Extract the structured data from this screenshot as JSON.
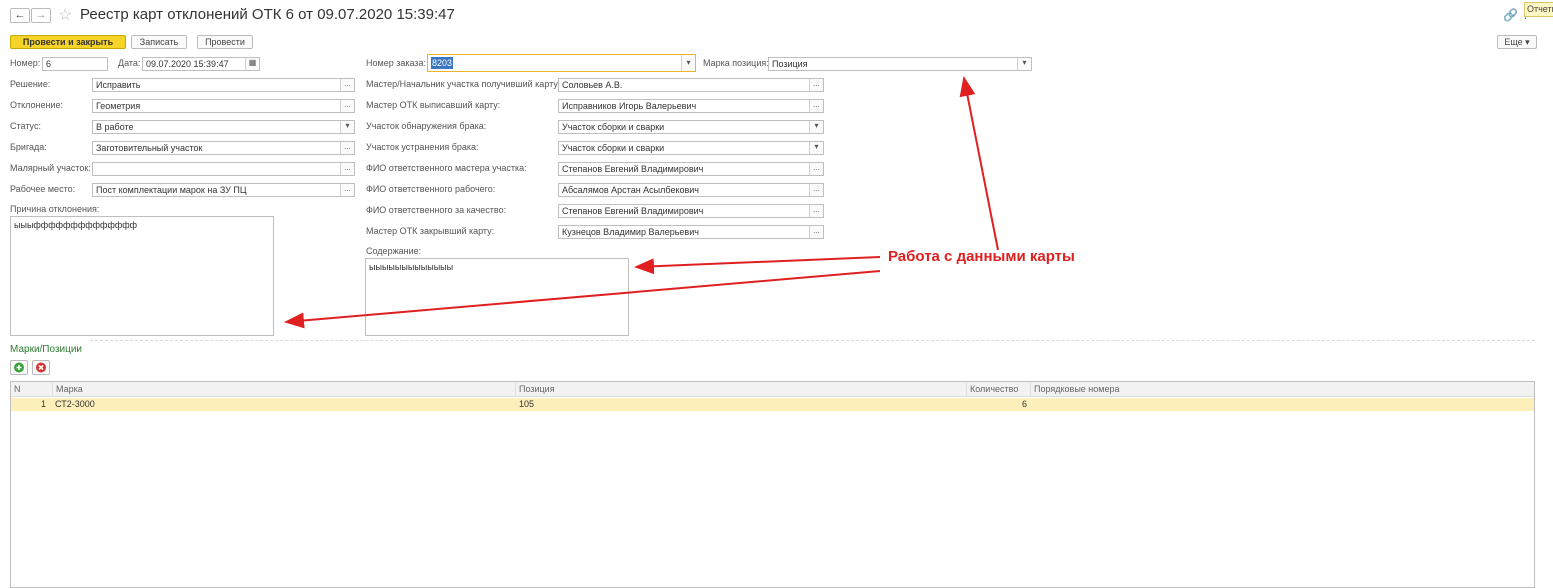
{
  "header": {
    "title": "Реестр карт отклонений ОТК 6 от 09.07.2020 15:39:47",
    "reports_label": "Отчеты"
  },
  "toolbar": {
    "post_close_label": "Провести и закрыть",
    "save_label": "Записать",
    "post_label": "Провести",
    "more_label": "Еще ▾"
  },
  "form": {
    "number_label": "Номер:",
    "number_value": "6",
    "date_label": "Дата:",
    "date_value": "09.07.2020 15:39:47",
    "decision_label": "Решение:",
    "decision_value": "Исправить",
    "deviation_label": "Отклонение:",
    "deviation_value": "Геометрия",
    "status_label": "Статус:",
    "status_value": "В работе",
    "brigade_label": "Бригада:",
    "brigade_value": "Заготовительный участок",
    "paint_label": "Малярный участок:",
    "paint_value": "",
    "workplace_label": "Рабочее место:",
    "workplace_value": "Пост комплектации марок на ЗУ ПЦ",
    "reason_label": "Причина отклонения:",
    "reason_value": "ыыыфффффффффффффф",
    "order_label": "Номер заказа:",
    "order_value": "8203",
    "mark_label": "Марка позиция:",
    "mark_value": "Позиция",
    "master_recv_label": "Мастер/Начальник участка получивший карту:",
    "master_recv_value": "Соловьев А.В.",
    "otk_issue_label": "Мастер ОТК выписавший карту:",
    "otk_issue_value": "Исправников Игорь Валерьевич",
    "detect_label": "Участок обнаружения брака:",
    "detect_value": "Участок сборки и сварки",
    "fix_label": "Участок устранения брака:",
    "fix_value": "Участок сборки и сварки",
    "resp_master_label": "ФИО ответственного мастера участка:",
    "resp_master_value": "Степанов Евгений Владимирович",
    "resp_worker_label": "ФИО ответственного рабочего:",
    "resp_worker_value": "Абсалямов Арстан Асылбекович",
    "resp_quality_label": "ФИО ответственного за качество:",
    "resp_quality_value": "Степанов Евгений Владимирович",
    "otk_close_label": "Мастер ОТК закрывший карту:",
    "otk_close_value": "Кузнецов Владимир Валерьевич",
    "content_label": "Содержание:",
    "content_value": "ыыыыыыыыыыыыы"
  },
  "annotation": {
    "text": "Работа с данными карты",
    "color": "#e02020"
  },
  "section": {
    "title": "Марки/Позиции"
  },
  "table": {
    "headers": [
      "N",
      "Марка",
      "Позиция",
      "Количество",
      "Порядковые номера"
    ],
    "rows": [
      {
        "n": "1",
        "mark": "СТ2-3000",
        "position": "105",
        "qty": "6",
        "serials": ""
      }
    ]
  },
  "colors": {
    "accent_button": "#f5d327",
    "section_green": "#2e7d32",
    "selected_row": "#fdefb9",
    "focus_border": "#f0b429"
  }
}
